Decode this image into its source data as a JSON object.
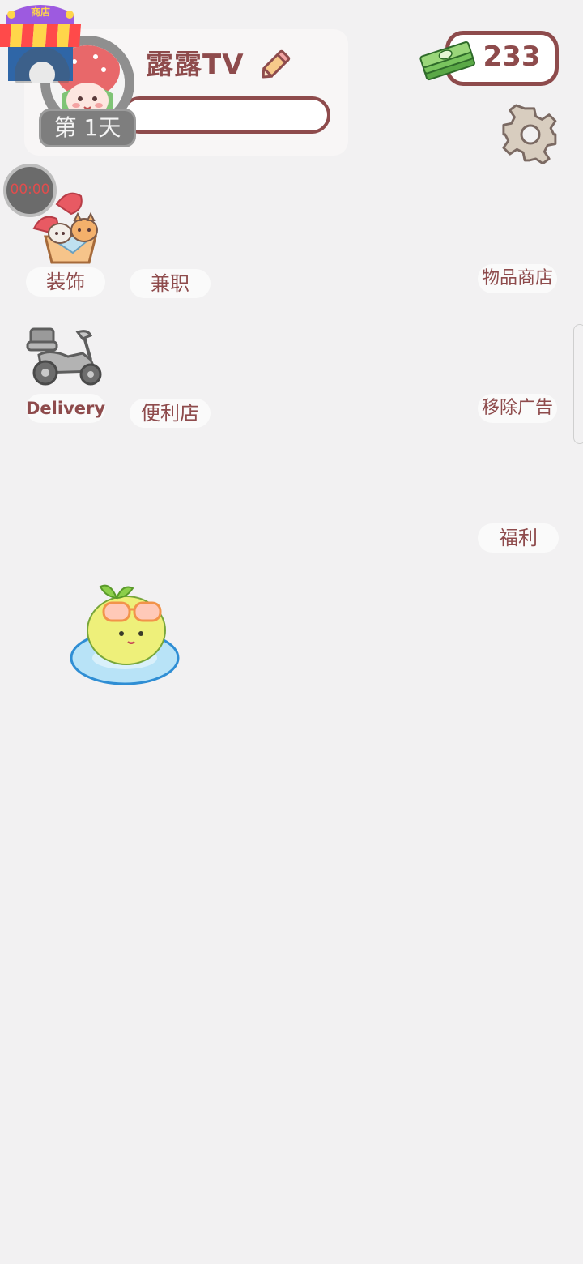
{
  "player": {
    "name": "露露TV",
    "day_label": "第 1天"
  },
  "shop": {
    "label": "商店"
  },
  "currency": {
    "amount": "233"
  },
  "timer": {
    "text": "00:00"
  },
  "menu": {
    "decor_label": "装饰",
    "parttime_label": "兼职",
    "item_shop_label": "物品商店",
    "delivery_label": "Delivery",
    "store_label": "便利店",
    "remove_ads_label": "移除广告",
    "welfare_label": "福利"
  },
  "colors": {
    "accent": "#8e4b4c",
    "background": "#f2f1f2",
    "timer_text": "#e14d4d"
  },
  "icons": {
    "shop": "shop-stall-icon",
    "cash": "cash-stack-icon",
    "settings": "gear-icon",
    "edit": "pencil-icon",
    "decor": "cat-basket-icon",
    "delivery": "scooter-icon"
  }
}
